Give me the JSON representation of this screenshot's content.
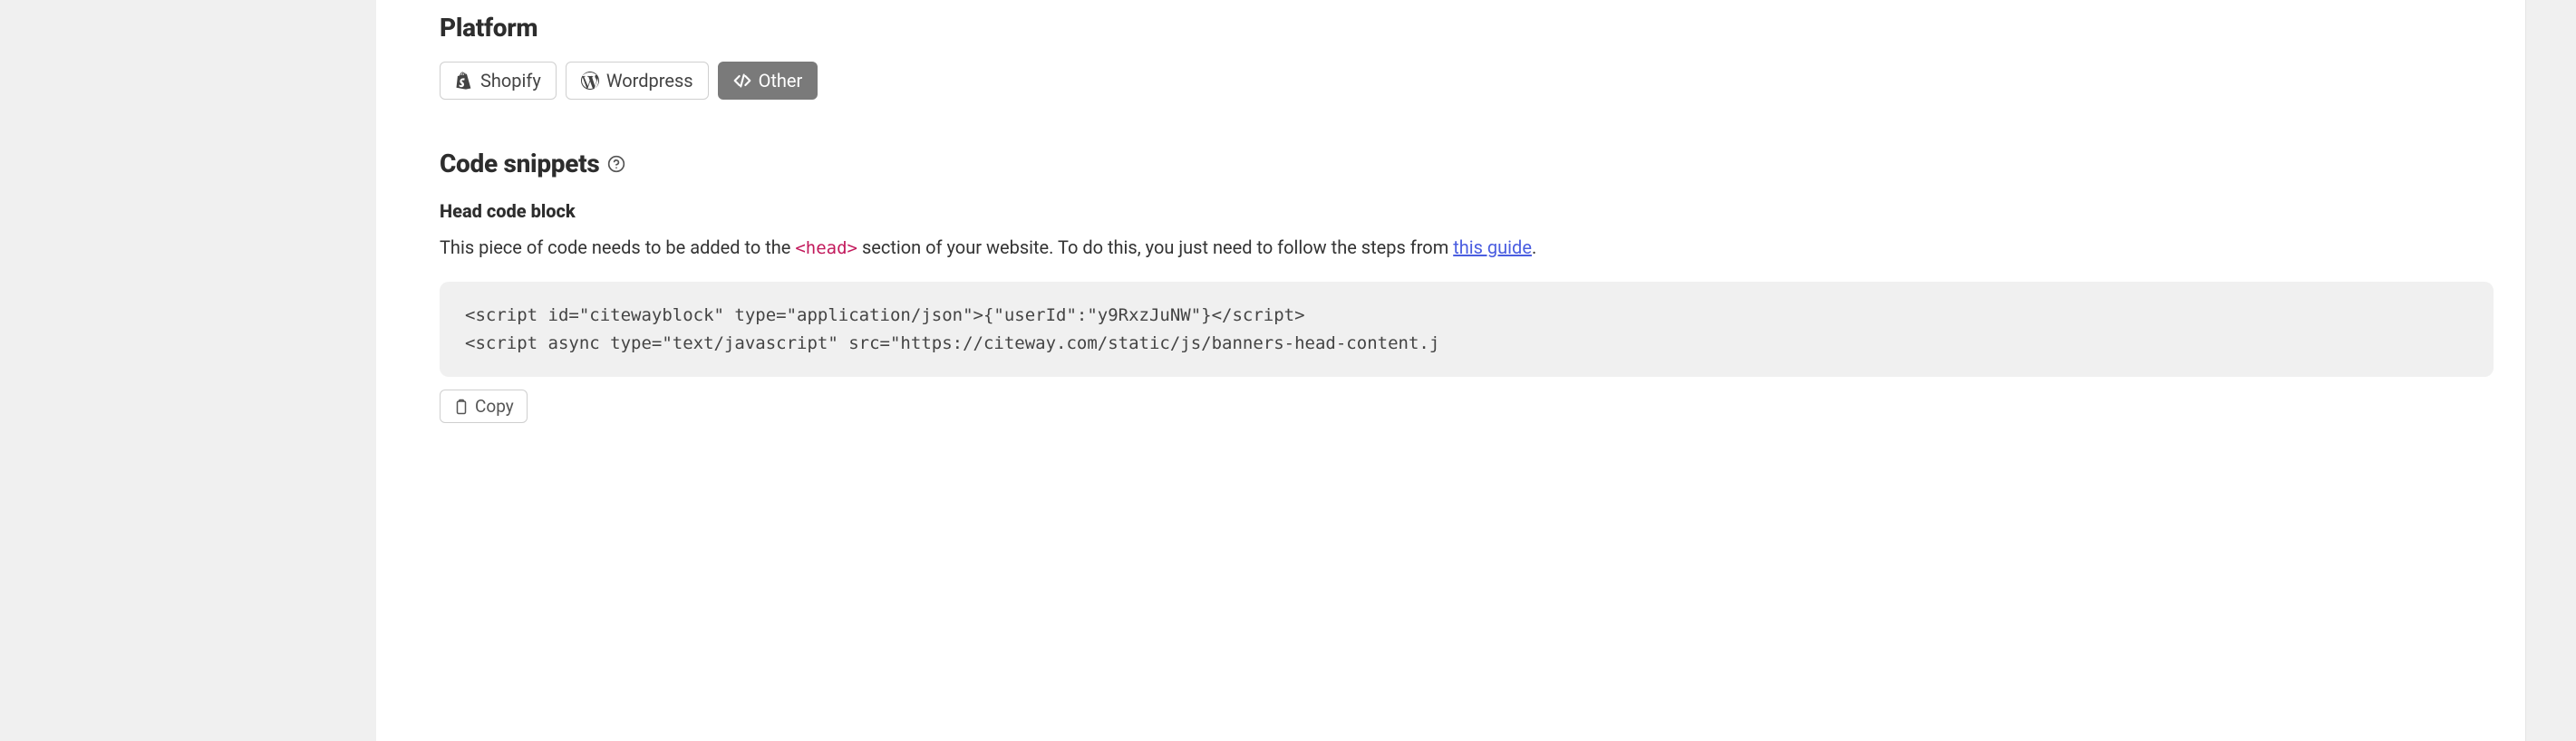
{
  "platform": {
    "title": "Platform",
    "tabs": [
      {
        "label": "Shopify",
        "icon": "shopify-icon",
        "active": false
      },
      {
        "label": "Wordpress",
        "icon": "wordpress-icon",
        "active": false
      },
      {
        "label": "Other",
        "icon": "code-icon",
        "active": true
      }
    ]
  },
  "snippets": {
    "title": "Code snippets",
    "head": {
      "title": "Head code block",
      "desc_before": "This piece of code needs to be added to the ",
      "desc_tag": "<head>",
      "desc_after": " section of your website. To do this, you just need to follow the steps from ",
      "guide_label": "this guide",
      "desc_end": ".",
      "code": "<script id=\"citewayblock\" type=\"application/json\">{\"userId\":\"y9RxzJuNW\"}</script>\n<script async type=\"text/javascript\" src=\"https://citeway.com/static/js/banners-head-content.j",
      "copy_label": "Copy"
    }
  }
}
